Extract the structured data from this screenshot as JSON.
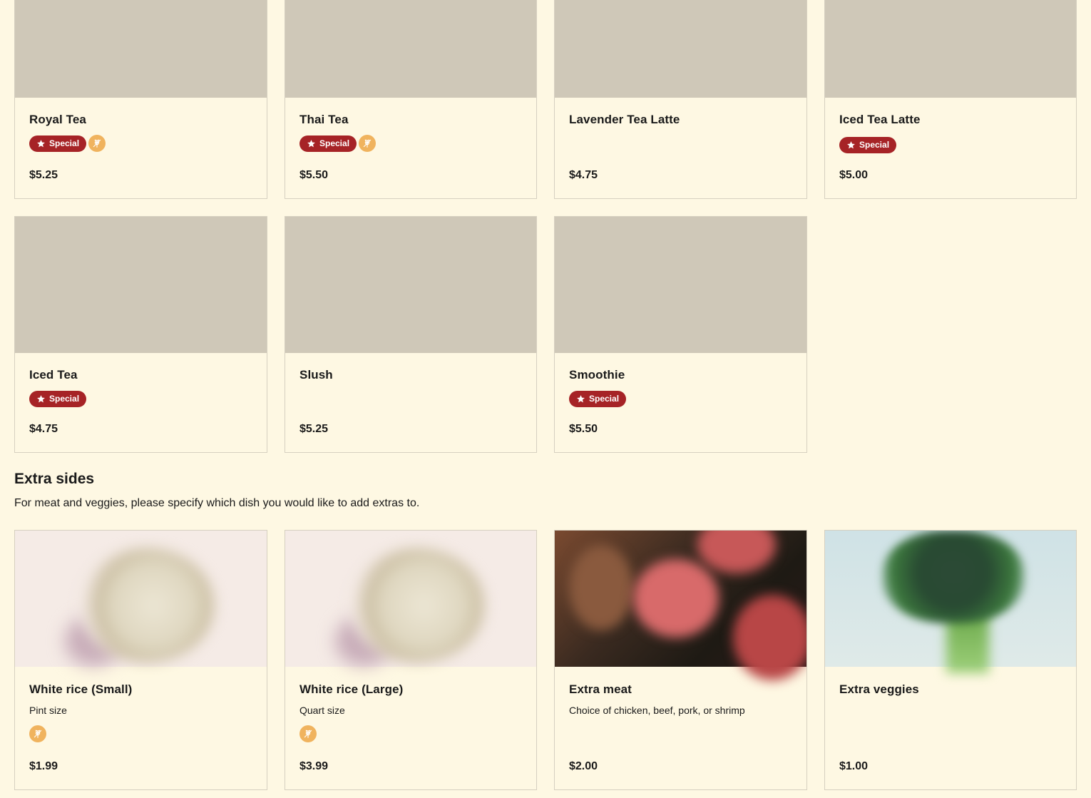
{
  "drinks": [
    {
      "name": "Royal Tea",
      "price": "$5.25",
      "special": true,
      "gluten_free": true
    },
    {
      "name": "Thai Tea",
      "price": "$5.50",
      "special": true,
      "gluten_free": true
    },
    {
      "name": "Lavender Tea Latte",
      "price": "$4.75",
      "special": false,
      "gluten_free": false
    },
    {
      "name": "Iced Tea Latte",
      "price": "$5.00",
      "special": true,
      "gluten_free": false
    },
    {
      "name": "Iced Tea",
      "price": "$4.75",
      "special": true,
      "gluten_free": false
    },
    {
      "name": "Slush",
      "price": "$5.25",
      "special": false,
      "gluten_free": false
    },
    {
      "name": "Smoothie",
      "price": "$5.50",
      "special": true,
      "gluten_free": false
    }
  ],
  "badge": {
    "special_label": "Special",
    "special_icon": "star-icon",
    "gluten_free_icon": "gluten-free-icon"
  },
  "extra_sides": {
    "title": "Extra sides",
    "subtitle": "For meat and veggies, please specify which dish you would like to add extras to.",
    "items": [
      {
        "name": "White rice (Small)",
        "description": "Pint size",
        "price": "$1.99",
        "gluten_free": true
      },
      {
        "name": "White rice (Large)",
        "description": "Quart size",
        "price": "$3.99",
        "gluten_free": true
      },
      {
        "name": "Extra meat",
        "description": "Choice of chicken, beef, pork, or shrimp",
        "price": "$2.00",
        "gluten_free": false
      },
      {
        "name": "Extra veggies",
        "description": "",
        "price": "$1.00",
        "gluten_free": false
      }
    ]
  },
  "colors": {
    "background": "#fef8e3",
    "placeholder": "#cfc8b8",
    "special_badge": "#a62326",
    "gluten_free_badge": "#f0b35e"
  }
}
